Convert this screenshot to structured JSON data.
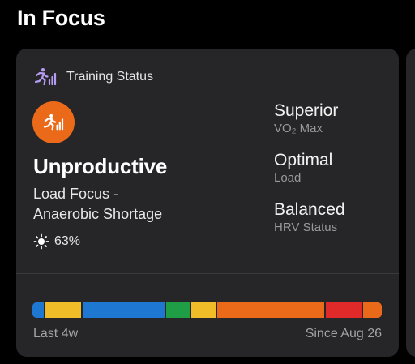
{
  "section": {
    "title": "In Focus"
  },
  "card": {
    "header_icon": "training-status-runner-icon",
    "header_label": "Training Status",
    "status_icon": "runner-bars-icon",
    "status_color": "#ea6a1a",
    "status": "Unproductive",
    "description_line1": "Load Focus -",
    "description_line2": "Anaerobic Shortage",
    "acclimation_icon": "sun-icon",
    "acclimation_value": "63%",
    "metrics": [
      {
        "value": "Superior",
        "label": "VO₂ Max"
      },
      {
        "value": "Optimal",
        "label": "Load"
      },
      {
        "value": "Balanced",
        "label": "HRV Status"
      }
    ],
    "history": {
      "start_label": "Last 4w",
      "end_label": "Since Aug 26",
      "segments": [
        {
          "color": "#1e78d2",
          "fraction": 0.033
        },
        {
          "color": "#f0bd28",
          "fraction": 0.105
        },
        {
          "color": "#1e78d2",
          "fraction": 0.244
        },
        {
          "color": "#1f9e45",
          "fraction": 0.07
        },
        {
          "color": "#f0bd28",
          "fraction": 0.07
        },
        {
          "color": "#ea6a1a",
          "fraction": 0.318
        },
        {
          "color": "#e02a2a",
          "fraction": 0.105
        },
        {
          "color": "#ea6a1a",
          "fraction": 0.055
        }
      ]
    }
  }
}
